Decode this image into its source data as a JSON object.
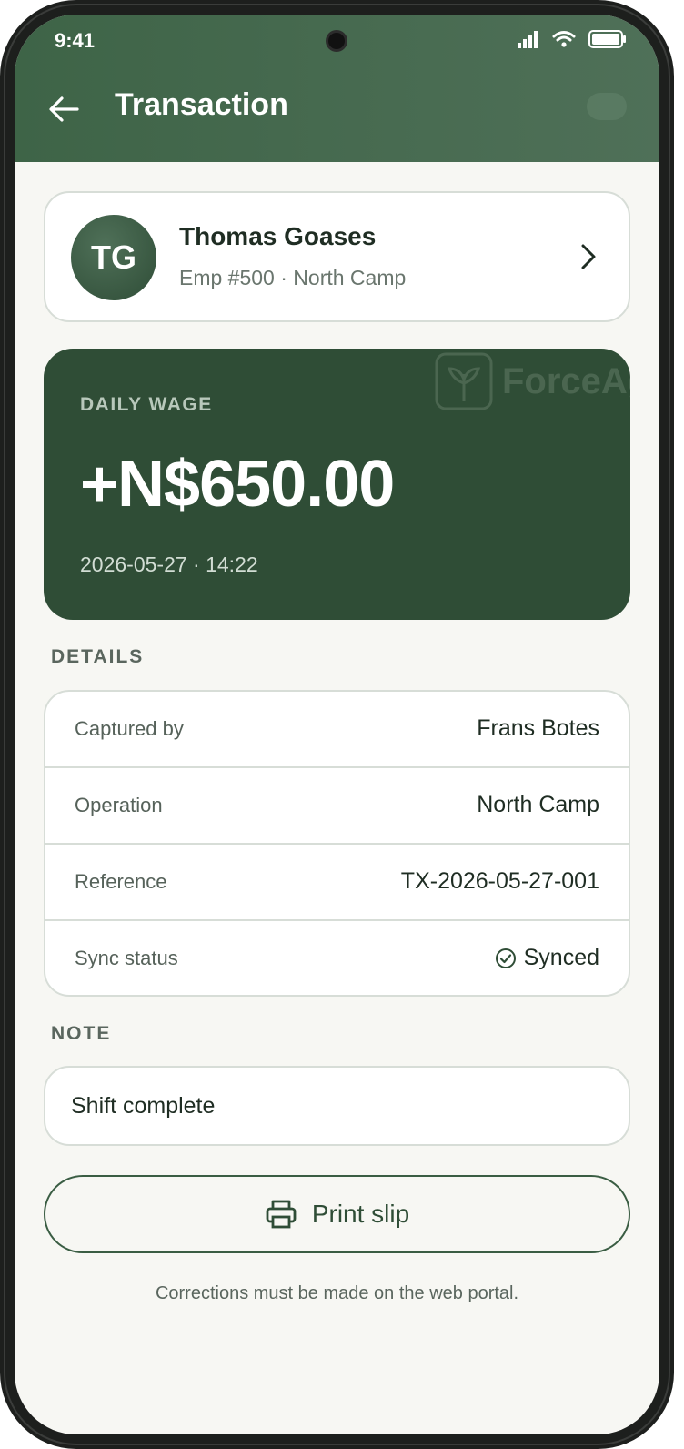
{
  "status_bar": {
    "time": "9:41"
  },
  "appbar": {
    "title": "Transaction"
  },
  "employee": {
    "initials": "TG",
    "name": "Thomas Goases",
    "subtitle": "Emp #500 · North Camp"
  },
  "wage": {
    "label": "DAILY WAGE",
    "amount": "+N$650.00",
    "datetime": "2026-05-27 · 14:22",
    "watermark": "ForceAg"
  },
  "details": {
    "section_label": "DETAILS",
    "rows": [
      {
        "label": "Captured by",
        "value": "Frans Botes"
      },
      {
        "label": "Operation",
        "value": "North Camp"
      },
      {
        "label": "Reference",
        "value": "TX-2026-05-27-001"
      },
      {
        "label": "Sync status",
        "value": "Synced"
      }
    ]
  },
  "note": {
    "section_label": "NOTE",
    "text": "Shift complete"
  },
  "actions": {
    "print_label": "Print slip"
  },
  "footer": {
    "text": "Corrections must be made on the web portal."
  },
  "colors": {
    "primary": "#3e6447",
    "wage_card": "#2f4d36",
    "background": "#f7f7f3"
  }
}
